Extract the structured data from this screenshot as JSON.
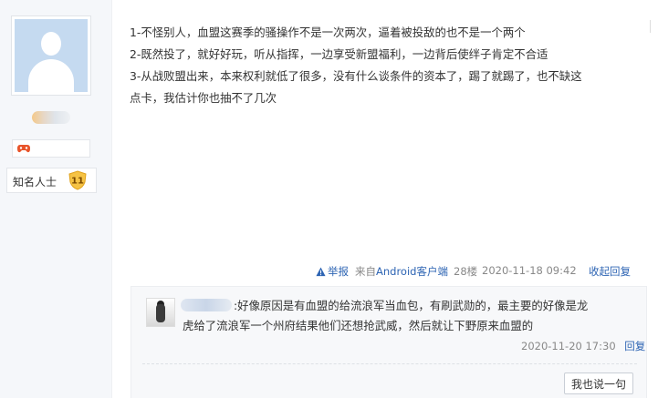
{
  "sidebar": {
    "title": "知名人士",
    "level": "11"
  },
  "post": {
    "lines": [
      "1-不怪别人，血盟这赛季的骚操作不是一次两次，逼着被投敌的也不是一个两个",
      "2-既然投了，就好好玩，听从指挥，一边享受新盟福利，一边背后使绊子肯定不合适",
      "3-从战败盟出来，本来权利就低了很多，没有什么谈条件的资本了，踢了就踢了，也不缺这",
      "点卡，我估计你也抽不了几次"
    ]
  },
  "meta": {
    "report": "举报",
    "source_prefix": "来自",
    "source_app": "Android客户端",
    "floor": "28楼",
    "time": "2020-11-18 09:42",
    "collapse": "收起回复"
  },
  "reply": {
    "line1": ":好像原因是有血盟的给流浪军当血包，有刷武勋的，最主要的好像是龙",
    "line2": "虎给了流浪军一个州府结果他们还想抢武威，然后就让下野原来血盟的",
    "time": "2020-11-20 17:30",
    "reply_label": "回复",
    "say_button": "我也说一句"
  }
}
